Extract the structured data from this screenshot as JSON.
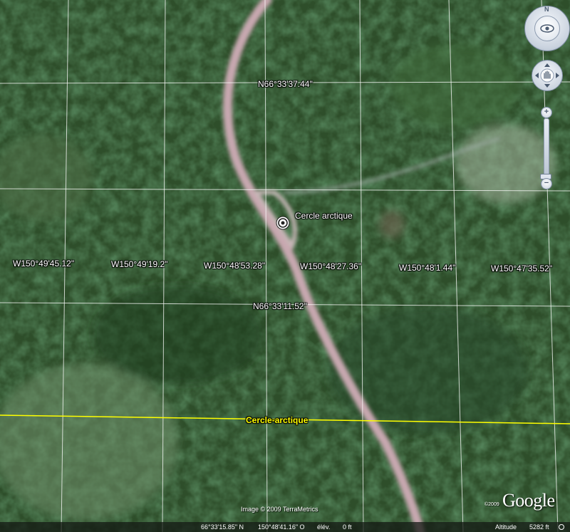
{
  "map": {
    "latitude_labels": [
      "N66°33'37.44\"",
      "N66°33'11.52\""
    ],
    "longitude_labels": [
      "W150°49'45.12\"",
      "W150°49'19.2\"",
      "W150°48'53.28\"",
      "W150°48'27.36\"",
      "W150°48'1.44\"",
      "W150°47'35.52\""
    ],
    "placemark": {
      "label": "Cercle arctique",
      "icon": "target-placemark-icon"
    },
    "circle_line": {
      "label": "Cercle-arctique",
      "color": "#ffff00"
    },
    "grid_color": "#ffffff",
    "road_color": "#c9a9b2"
  },
  "controls": {
    "north_label": "N",
    "zoom_in": "+",
    "zoom_out": "−",
    "zoom_level": 0.98
  },
  "attribution": {
    "imagery": "Image © 2009 TerraMetrics",
    "year": "©2009",
    "logo": "Google"
  },
  "status": {
    "latitude": "66°33'15.85\" N",
    "longitude": "150°48'41.16\" O",
    "elevation_label": "élév.",
    "elevation_value": "0 ft",
    "altitude_label": "Altitude",
    "altitude_value": "5282 ft"
  }
}
